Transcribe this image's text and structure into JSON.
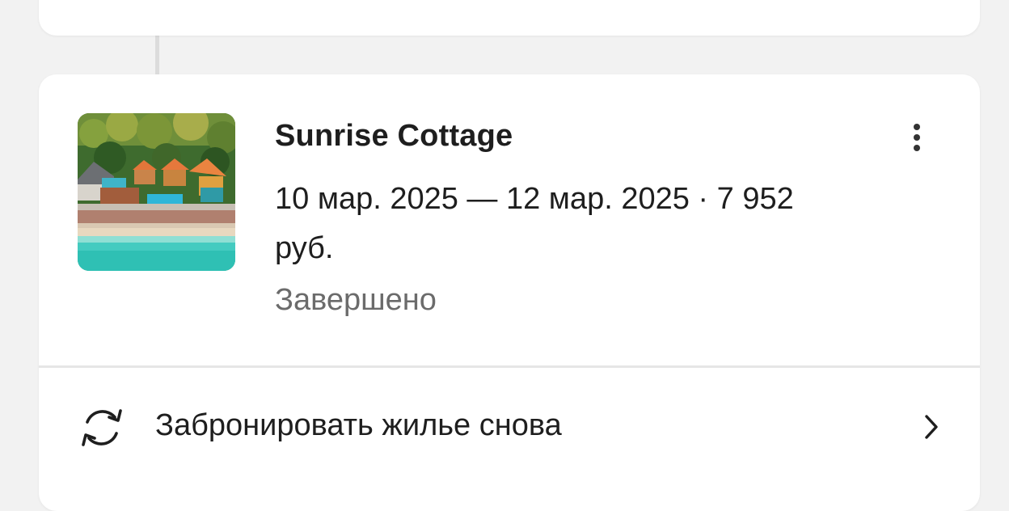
{
  "booking": {
    "title": "Sunrise Cottage",
    "details": "10 мар. 2025 — 12 мар. 2025 · 7 952 руб.",
    "status": "Завершено",
    "thumbnail_icon": "resort-photo"
  },
  "actions": {
    "more_icon": "more-vertical-icon",
    "rebook_label": "Забронировать жилье снова",
    "rebook_icon": "refresh-icon",
    "chevron_icon": "chevron-right-icon"
  },
  "colors": {
    "background": "#f2f2f2",
    "card": "#ffffff",
    "text_primary": "#1e1e1e",
    "text_secondary": "#6b6b6b"
  }
}
